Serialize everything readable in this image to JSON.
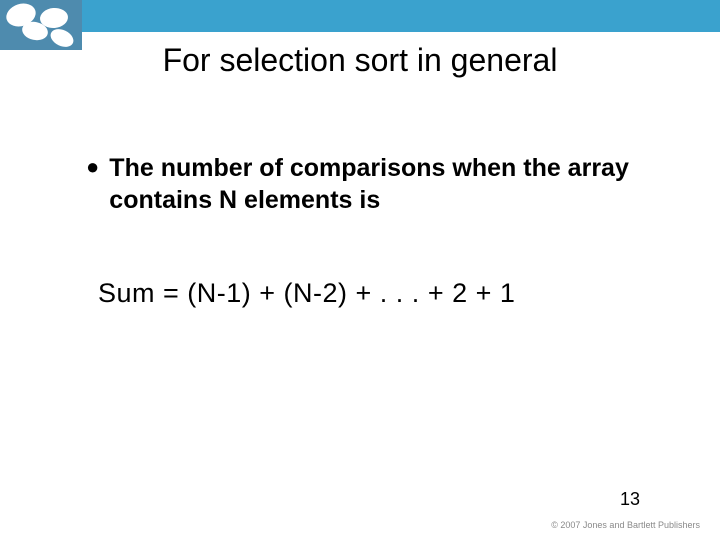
{
  "header": {
    "title": "For selection sort in general"
  },
  "bullet": {
    "text": "The number of comparisons when the array contains N elements is"
  },
  "formula": {
    "text": "Sum = (N-1)  +   (N-2)  + .   .   .  +  2  +  1"
  },
  "footer": {
    "page": "13",
    "watermark": "© 2007 Jones and Bartlett Publishers"
  }
}
